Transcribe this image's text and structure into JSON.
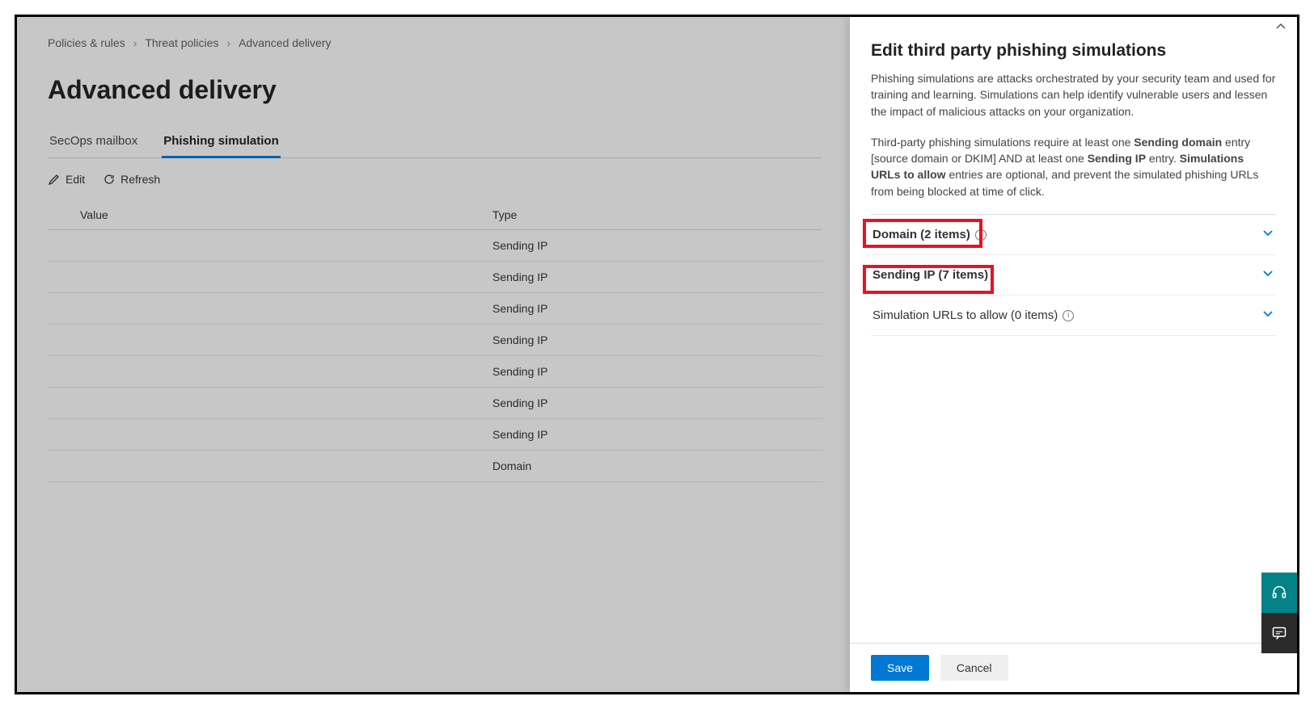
{
  "breadcrumb": {
    "level1": "Policies & rules",
    "level2": "Threat policies",
    "level3": "Advanced delivery"
  },
  "page": {
    "title": "Advanced delivery"
  },
  "tabs": {
    "secops": "SecOps mailbox",
    "phishing": "Phishing simulation"
  },
  "toolbar": {
    "edit": "Edit",
    "refresh": "Refresh"
  },
  "table": {
    "headers": {
      "value": "Value",
      "type": "Type"
    },
    "rows": [
      {
        "value": "",
        "type": "Sending IP"
      },
      {
        "value": "",
        "type": "Sending IP"
      },
      {
        "value": "",
        "type": "Sending IP"
      },
      {
        "value": "",
        "type": "Sending IP"
      },
      {
        "value": "",
        "type": "Sending IP"
      },
      {
        "value": "",
        "type": "Sending IP"
      },
      {
        "value": "",
        "type": "Sending IP"
      },
      {
        "value": "",
        "type": "Domain"
      }
    ]
  },
  "panel": {
    "title": "Edit third party phishing simulations",
    "desc1": "Phishing simulations are attacks orchestrated by your security team and used for training and learning. Simulations can help identify vulnerable users and lessen the impact of malicious attacks on your organization.",
    "desc2_a": "Third-party phishing simulations require at least one ",
    "desc2_b": "Sending domain",
    "desc2_c": " entry [source domain or DKIM] AND at least one ",
    "desc2_d": "Sending IP",
    "desc2_e": " entry. ",
    "desc2_f": "Simulations URLs to allow",
    "desc2_g": " entries are optional, and prevent the simulated phishing URLs from being blocked at time of click.",
    "accordion": {
      "domain": "Domain (2 items)",
      "sendingip": "Sending IP (7 items)",
      "urls": "Simulation URLs to allow (0 items)"
    },
    "buttons": {
      "save": "Save",
      "cancel": "Cancel"
    }
  }
}
